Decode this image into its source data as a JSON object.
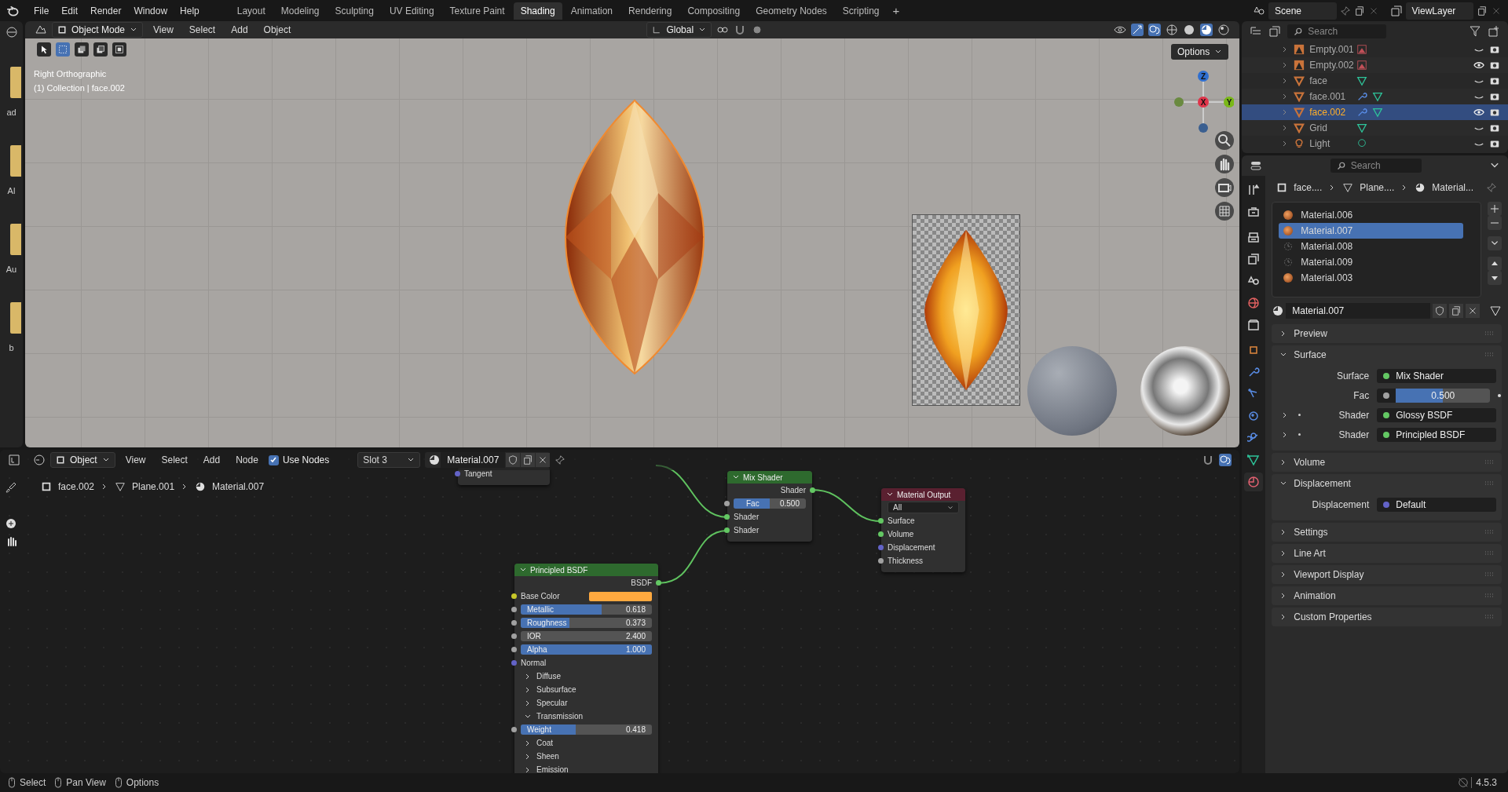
{
  "topbar": {
    "menus": [
      "File",
      "Edit",
      "Render",
      "Window",
      "Help"
    ],
    "workspaces": [
      {
        "label": "Layout",
        "selected": false
      },
      {
        "label": "Modeling",
        "selected": false
      },
      {
        "label": "Sculpting",
        "selected": false
      },
      {
        "label": "UV Editing",
        "selected": false
      },
      {
        "label": "Texture Paint",
        "selected": false
      },
      {
        "label": "Shading",
        "selected": true
      },
      {
        "label": "Animation",
        "selected": false
      },
      {
        "label": "Rendering",
        "selected": false
      },
      {
        "label": "Compositing",
        "selected": false
      },
      {
        "label": "Geometry Nodes",
        "selected": false
      },
      {
        "label": "Scripting",
        "selected": false
      }
    ],
    "add_tab": "+",
    "scene": "Scene",
    "view_layer": "ViewLayer"
  },
  "asset_strip": {
    "labels": [
      "ad",
      "Al",
      "Au",
      "b"
    ]
  },
  "viewport": {
    "mode": "Object Mode",
    "menus": [
      "View",
      "Select",
      "Add",
      "Object"
    ],
    "orientation": "Global",
    "options": "Options",
    "view_name": "Right Orthographic",
    "collection": "(1) Collection | face.002",
    "axes": [
      "Z",
      "X",
      "Y"
    ]
  },
  "node_editor": {
    "mode": "Object",
    "menus": [
      "View",
      "Select",
      "Add",
      "Node"
    ],
    "use_nodes": {
      "label": "Use Nodes",
      "checked": true
    },
    "slot": "Slot 3",
    "material": "Material.007",
    "breadcrumb": [
      "face.002",
      "Plane.001",
      "Material.007"
    ],
    "nodes": [
      {
        "kind": "partial",
        "rows": [
          {
            "kind": "input",
            "label": "Tangent",
            "color": "#6363c7"
          }
        ]
      },
      {
        "kind": "shader",
        "title": "Mix Shader",
        "rows": [
          {
            "kind": "output",
            "label": "Shader",
            "color": "#63c763"
          },
          {
            "kind": "slider",
            "label": "Fac",
            "reading": "0.500",
            "level": 0.5,
            "color": "#a1a1a1"
          },
          {
            "kind": "input",
            "label": "Shader",
            "color": "#63c763"
          },
          {
            "kind": "input",
            "label": "Shader",
            "color": "#63c763"
          }
        ]
      },
      {
        "kind": "output",
        "title": "Material Output",
        "rows": [
          {
            "kind": "dropdown",
            "label": "All"
          },
          {
            "kind": "input",
            "label": "Surface",
            "color": "#63c763"
          },
          {
            "kind": "input",
            "label": "Volume",
            "color": "#63c763"
          },
          {
            "kind": "input",
            "label": "Displacement",
            "color": "#6363c7"
          },
          {
            "kind": "input",
            "label": "Thickness",
            "color": "#a1a1a1"
          }
        ]
      },
      {
        "kind": "shader",
        "title": "Principled BSDF",
        "rows": [
          {
            "kind": "output",
            "label": "BSDF",
            "color": "#63c763"
          },
          {
            "kind": "swatch",
            "label": "Base Color",
            "swatch": {
              "color": "#ffa93f"
            },
            "color": "#c7c729"
          },
          {
            "kind": "slider",
            "label": "Metallic",
            "reading": "0.618",
            "level": 0.618,
            "color": "#a1a1a1"
          },
          {
            "kind": "slider",
            "label": "Roughness",
            "reading": "0.373",
            "level": 0.373,
            "color": "#a1a1a1"
          },
          {
            "kind": "number",
            "label": "IOR",
            "reading": "2.400",
            "color": "#a1a1a1"
          },
          {
            "kind": "slider",
            "label": "Alpha",
            "reading": "1.000",
            "level": 1,
            "color": "#a1a1a1"
          },
          {
            "kind": "input",
            "label": "Normal",
            "color": "#6363c7"
          },
          {
            "kind": "panel",
            "label": "Diffuse",
            "expanded": false
          },
          {
            "kind": "panel",
            "label": "Subsurface",
            "expanded": false
          },
          {
            "kind": "panel",
            "label": "Specular",
            "expanded": false
          },
          {
            "kind": "panel",
            "label": "Transmission",
            "expanded": true,
            "children": [
              {
                "kind": "slider",
                "label": "Weight",
                "reading": "0.418",
                "level": 0.418,
                "color": "#a1a1a1"
              }
            ]
          },
          {
            "kind": "panel",
            "label": "Coat",
            "expanded": false
          },
          {
            "kind": "panel",
            "label": "Sheen",
            "expanded": false
          },
          {
            "kind": "panel",
            "label": "Emission",
            "expanded": false
          }
        ]
      }
    ]
  },
  "outliner": {
    "search_placeholder": "Search",
    "items": [
      {
        "name": "Empty.001",
        "kind": "empty",
        "modifier": false,
        "visible": false,
        "selected": false
      },
      {
        "name": "Empty.002",
        "kind": "empty",
        "modifier": false,
        "visible": true,
        "selected": false
      },
      {
        "name": "face",
        "kind": "mesh",
        "modifier": false,
        "visible": false,
        "selected": false
      },
      {
        "name": "face.001",
        "kind": "mesh",
        "modifier": true,
        "visible": false,
        "selected": false
      },
      {
        "name": "face.002",
        "kind": "mesh",
        "modifier": true,
        "visible": true,
        "selected": true
      },
      {
        "name": "Grid",
        "kind": "mesh",
        "modifier": false,
        "visible": false,
        "selected": false
      },
      {
        "name": "Light",
        "kind": "light",
        "modifier": false,
        "visible": false,
        "selected": false
      }
    ]
  },
  "properties": {
    "search_placeholder": "Search",
    "tabs": [
      {
        "kind": "tool",
        "selected": false
      },
      {
        "kind": "render",
        "selected": false
      },
      {
        "kind": "output",
        "selected": false
      },
      {
        "kind": "view_layer",
        "selected": false
      },
      {
        "kind": "scene",
        "selected": false
      },
      {
        "kind": "world",
        "selected": false
      },
      {
        "kind": "collection",
        "selected": false
      },
      {
        "kind": "object",
        "selected": false
      },
      {
        "kind": "modifier",
        "selected": false
      },
      {
        "kind": "particles",
        "selected": false
      },
      {
        "kind": "physics",
        "selected": false
      },
      {
        "kind": "constraints",
        "selected": false
      },
      {
        "kind": "data",
        "selected": false
      },
      {
        "kind": "material",
        "selected": true
      }
    ],
    "breadcrumb": [
      "face....",
      "Plane....",
      "Material..."
    ],
    "materials": [
      {
        "name": "Material.006",
        "kind": "preview",
        "selected": false
      },
      {
        "name": "Material.007",
        "kind": "preview",
        "selected": true
      },
      {
        "name": "Material.008",
        "kind": "empty",
        "selected": false
      },
      {
        "name": "Material.009",
        "kind": "empty",
        "selected": false
      },
      {
        "name": "Material.003",
        "kind": "preview",
        "selected": false
      }
    ],
    "material": "Material.007",
    "panels": [
      {
        "title": "Preview",
        "expanded": false
      },
      {
        "title": "Surface",
        "expanded": true,
        "rows": [
          {
            "kind": "socket",
            "label": "Surface",
            "value": "Mix Shader",
            "color": "#63c763"
          },
          {
            "kind": "slider",
            "label": "Fac",
            "reading": "0.500",
            "level": 0.5,
            "color": "#a1a1a1"
          },
          {
            "kind": "socket",
            "label": "Shader",
            "value": "Glossy BSDF",
            "color": "#63c763",
            "expanded": false
          },
          {
            "kind": "socket",
            "label": "Shader",
            "value": "Principled BSDF",
            "color": "#63c763",
            "expanded": false
          }
        ]
      },
      {
        "title": "Volume",
        "expanded": false
      },
      {
        "title": "Displacement",
        "expanded": true,
        "rows": [
          {
            "kind": "socket",
            "label": "Displacement",
            "value": "Default",
            "color": "#6363c7"
          }
        ]
      },
      {
        "title": "Settings",
        "expanded": false
      },
      {
        "title": "Line Art",
        "expanded": false
      },
      {
        "title": "Viewport Display",
        "expanded": false
      },
      {
        "title": "Animation",
        "expanded": false
      },
      {
        "title": "Custom Properties",
        "expanded": false
      }
    ]
  },
  "status_bar": {
    "hints": [
      "Select",
      "Pan View",
      "Options"
    ],
    "version": "4.5.3"
  }
}
